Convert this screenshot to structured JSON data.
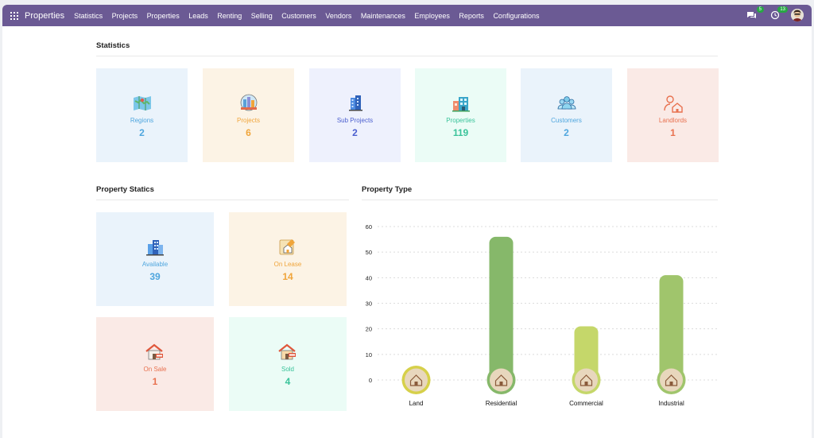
{
  "navbar": {
    "brand": "Properties",
    "menu": [
      "Statistics",
      "Projects",
      "Properties",
      "Leads",
      "Renting",
      "Selling",
      "Customers",
      "Vendors",
      "Maintenances",
      "Employees",
      "Reports",
      "Configurations"
    ],
    "messages_count": "5",
    "activities_count": "13"
  },
  "statistics": {
    "title": "Statistics",
    "cards": [
      {
        "label": "Regions",
        "value": "2",
        "icon": "map-icon",
        "bg": "#eaf3fb",
        "color": "#4fa6de"
      },
      {
        "label": "Projects",
        "value": "6",
        "icon": "globe-building-icon",
        "bg": "#fcf3e5",
        "color": "#f0a53b"
      },
      {
        "label": "Sub Projects",
        "value": "2",
        "icon": "building-icon",
        "bg": "#eef1fd",
        "color": "#4b5fcf"
      },
      {
        "label": "Properties",
        "value": "119",
        "icon": "houses-icon",
        "bg": "#ebfcf6",
        "color": "#39c39a"
      },
      {
        "label": "Customers",
        "value": "2",
        "icon": "users-icon",
        "bg": "#eaf3fb",
        "color": "#4fa6de"
      },
      {
        "label": "Landlords",
        "value": "1",
        "icon": "landlord-icon",
        "bg": "#faeae6",
        "color": "#e8714f"
      }
    ]
  },
  "property_statics": {
    "title": "Property Statics",
    "cards": [
      {
        "label": "Available",
        "value": "39",
        "icon": "buildings-icon",
        "bg": "#eaf3fb",
        "color": "#4fa6de"
      },
      {
        "label": "On Lease",
        "value": "14",
        "icon": "lease-house-icon",
        "bg": "#fcf3e5",
        "color": "#f0a53b"
      },
      {
        "label": "On Sale",
        "value": "1",
        "icon": "sale-house-icon",
        "bg": "#faeae6",
        "color": "#e8714f"
      },
      {
        "label": "Sold",
        "value": "4",
        "icon": "sold-house-icon",
        "bg": "#ebfcf6",
        "color": "#39c39a"
      }
    ]
  },
  "property_type": {
    "title": "Property Type"
  },
  "chart_data": {
    "type": "bar",
    "title": "",
    "categories": [
      "Land",
      "Residential",
      "Commercial",
      "Industrial"
    ],
    "values": [
      0,
      56,
      21,
      41
    ],
    "ylim": [
      0,
      60
    ],
    "yticks": [
      0,
      10,
      20,
      30,
      40,
      50,
      60
    ],
    "grid": true,
    "colors": [
      "#d6d04a",
      "#86b86a",
      "#c5d76a",
      "#a0c56c"
    ]
  }
}
